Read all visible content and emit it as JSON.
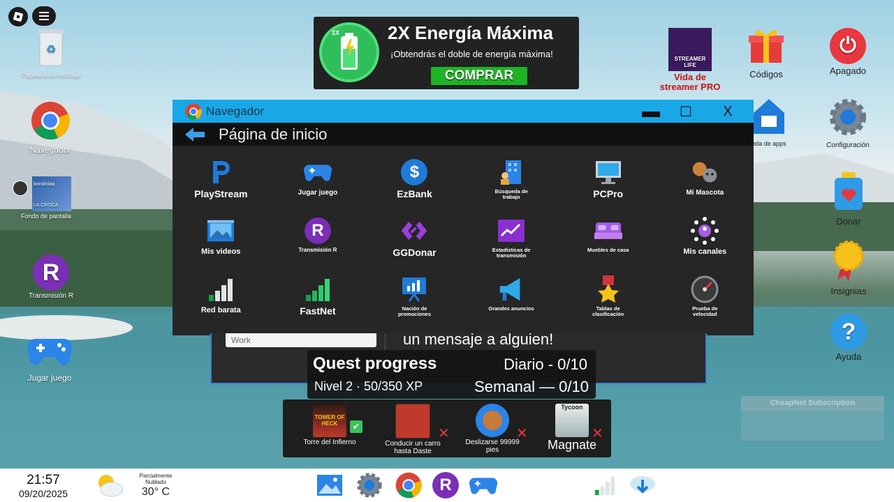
{
  "desktop": {
    "left_icons": [
      {
        "label": "Papelera de reciclaje"
      },
      {
        "label": "Navegador"
      },
      {
        "label": "Fondo de pantalla",
        "tag": "bondiolaa",
        "tag2": "LA CROCA"
      },
      {
        "label": "Transmisión R"
      },
      {
        "label": "Jugar juego"
      }
    ],
    "right_icons": [
      {
        "label": "Vida de streamer PRO",
        "thumb_text": "STREAMER LIFE"
      },
      {
        "label": "Códigos"
      },
      {
        "label": "Apagado"
      },
      {
        "label": "nda de apps"
      },
      {
        "label": "Configuración"
      },
      {
        "label": "Donar"
      },
      {
        "label": "Insignias"
      },
      {
        "label": "Ayuda"
      }
    ]
  },
  "ad": {
    "badge": "2X",
    "title": "2X Energía Máxima",
    "subtitle": "¡Obtendrás el doble de energía máxima!",
    "button": "COMPRAR"
  },
  "browser": {
    "title": "Navegador",
    "btn_min": "—",
    "btn_max": "☐",
    "btn_close": "X",
    "page_title": "Página de inicio",
    "apps": [
      {
        "label": "PlayStream",
        "icon": "playstream-icon"
      },
      {
        "label": "Jugar juego",
        "icon": "gamepad-icon"
      },
      {
        "label": "EzBank",
        "icon": "dollar-icon"
      },
      {
        "label": "Búsqueda de trabajo",
        "icon": "job-search-icon"
      },
      {
        "label": "PCPro",
        "icon": "monitor-icon"
      },
      {
        "label": "Mi Mascota",
        "icon": "pets-icon"
      },
      {
        "label": "Mis videos",
        "icon": "video-icon"
      },
      {
        "label": "Transmisión R",
        "icon": "r-icon"
      },
      {
        "label": "GGDonar",
        "icon": "ggdonar-icon"
      },
      {
        "label": "Estadísticas de transmisión",
        "icon": "stats-icon"
      },
      {
        "label": "Muebles de casa",
        "icon": "bed-icon"
      },
      {
        "label": "Mis canales",
        "icon": "channels-icon"
      },
      {
        "label": "Red barata",
        "icon": "signal-low-icon"
      },
      {
        "label": "FastNet",
        "icon": "signal-full-icon"
      },
      {
        "label": "Nación de promociones",
        "icon": "presentation-icon"
      },
      {
        "label": "Grandes anuncios",
        "icon": "megaphone-icon"
      },
      {
        "label": "Tablas de clasificación",
        "icon": "medal-icon"
      },
      {
        "label": "Prueba de velocidad",
        "icon": "speedometer-icon"
      }
    ]
  },
  "under_panel": {
    "input_value": "Work",
    "message": "un mensaje a alguien!"
  },
  "quest": {
    "title": "Quest progress",
    "daily": "Diario - 0/10",
    "level": "Nivel 2 · 50/350 XP",
    "weekly": "Semanal — 0/10"
  },
  "games": [
    {
      "label": "Torre del Infierno",
      "status": "✔",
      "thumb": "TOWER OF HECK"
    },
    {
      "label": "Conducir un carro hasta Daste",
      "status": "✕"
    },
    {
      "label": "Deslizarse 99999 pies",
      "status": "✕"
    },
    {
      "label": "Magnate",
      "status": "✕",
      "thumb": "Tycoon"
    }
  ],
  "cheapnet": {
    "title": "CheapNet Subscription"
  },
  "taskbar": {
    "time": "21:57",
    "date": "09/20/2025",
    "weather_cond": "Parcialmente Nublado",
    "temp": "30° C"
  }
}
